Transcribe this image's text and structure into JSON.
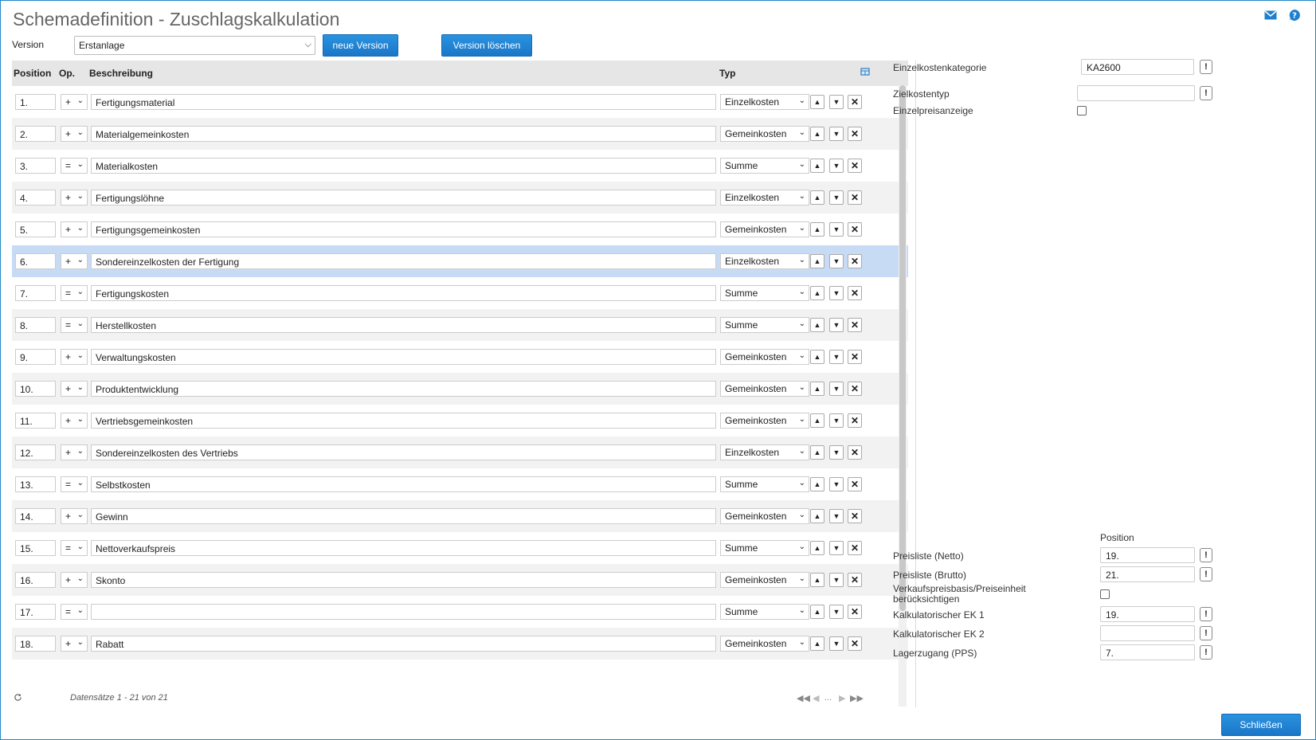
{
  "window": {
    "title": "Schemadefinition - Zuschlagskalkulation",
    "icons": [
      "mail-icon",
      "help-icon"
    ]
  },
  "version": {
    "label": "Version",
    "selected": "Erstanlage",
    "new_button": "neue Version",
    "delete_button": "Version löschen"
  },
  "grid": {
    "columns": {
      "position": "Position",
      "op": "Op.",
      "beschreibung": "Beschreibung",
      "typ": "Typ"
    },
    "rows": [
      {
        "pos": "1.",
        "op": "+",
        "desc": "Fertigungsmaterial",
        "typ": "Einzelkosten"
      },
      {
        "pos": "2.",
        "op": "+",
        "desc": "Materialgemeinkosten",
        "typ": "Gemeinkosten"
      },
      {
        "pos": "3.",
        "op": "=",
        "desc": "Materialkosten",
        "typ": "Summe"
      },
      {
        "pos": "4.",
        "op": "+",
        "desc": "Fertigungslöhne",
        "typ": "Einzelkosten"
      },
      {
        "pos": "5.",
        "op": "+",
        "desc": "Fertigungsgemeinkosten",
        "typ": "Gemeinkosten"
      },
      {
        "pos": "6.",
        "op": "+",
        "desc": "Sondereinzelkosten der Fertigung",
        "typ": "Einzelkosten"
      },
      {
        "pos": "7.",
        "op": "=",
        "desc": "Fertigungskosten",
        "typ": "Summe"
      },
      {
        "pos": "8.",
        "op": "=",
        "desc": "Herstellkosten",
        "typ": "Summe"
      },
      {
        "pos": "9.",
        "op": "+",
        "desc": "Verwaltungskosten",
        "typ": "Gemeinkosten"
      },
      {
        "pos": "10.",
        "op": "+",
        "desc": "Produktentwicklung",
        "typ": "Gemeinkosten"
      },
      {
        "pos": "11.",
        "op": "+",
        "desc": "Vertriebsgemeinkosten",
        "typ": "Gemeinkosten"
      },
      {
        "pos": "12.",
        "op": "+",
        "desc": "Sondereinzelkosten des Vertriebs",
        "typ": "Einzelkosten"
      },
      {
        "pos": "13.",
        "op": "=",
        "desc": "Selbstkosten",
        "typ": "Summe"
      },
      {
        "pos": "14.",
        "op": "+",
        "desc": "Gewinn",
        "typ": "Gemeinkosten"
      },
      {
        "pos": "15.",
        "op": "=",
        "desc": "Nettoverkaufspreis",
        "typ": "Summe"
      },
      {
        "pos": "16.",
        "op": "+",
        "desc": "Skonto",
        "typ": "Gemeinkosten"
      },
      {
        "pos": "17.",
        "op": "=",
        "desc": "",
        "typ": "Summe"
      },
      {
        "pos": "18.",
        "op": "+",
        "desc": "Rabatt",
        "typ": "Gemeinkosten"
      }
    ],
    "footer": "Datensätze 1 - 21 von 21",
    "pager_ellipsis": "..."
  },
  "side": {
    "einzelkostenkategorie": {
      "label": "Einzelkostenkategorie",
      "value": "KA2600"
    },
    "zielkostentyp": {
      "label": "Zielkostentyp",
      "value": ""
    },
    "einzelpreisanzeige": {
      "label": "Einzelpreisanzeige"
    },
    "position_header": "Position",
    "preisliste_netto": {
      "label": "Preisliste (Netto)",
      "value": "19."
    },
    "preisliste_brutto": {
      "label": "Preisliste (Brutto)",
      "value": "21."
    },
    "verkaufspreisbasis": {
      "label1": "Verkaufspreisbasis/Preiseinheit",
      "label2": "berücksichtigen"
    },
    "kalk_ek1": {
      "label": "Kalkulatorischer EK 1",
      "value": "19."
    },
    "kalk_ek2": {
      "label": "Kalkulatorischer EK 2",
      "value": ""
    },
    "lagerzugang": {
      "label": "Lagerzugang (PPS)",
      "value": "7."
    }
  },
  "close_button": "Schließen"
}
